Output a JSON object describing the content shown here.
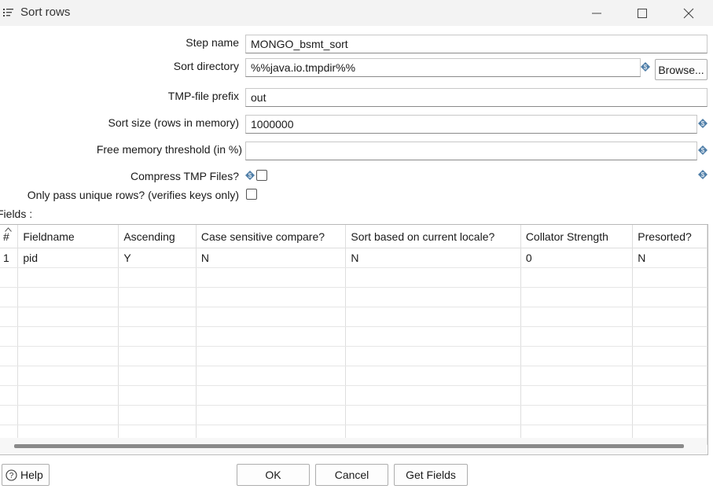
{
  "window": {
    "title": "Sort rows",
    "icon": "sort-list-icon"
  },
  "form": {
    "step_name_label": "Step name",
    "step_name_value": "MONGO_bsmt_sort",
    "sort_directory_label": "Sort directory",
    "sort_directory_value": "%%java.io.tmpdir%%",
    "browse_label": "Browse...",
    "tmp_prefix_label": "TMP-file prefix",
    "tmp_prefix_value": "out",
    "sort_size_label": "Sort size (rows in memory)",
    "sort_size_value": "1000000",
    "free_memory_label": "Free memory threshold (in %)",
    "free_memory_value": "",
    "compress_label": "Compress TMP Files?",
    "compress_checked": false,
    "unique_label": "Only pass unique rows? (verifies keys only)",
    "unique_checked": false,
    "variable_icon": "variable-diamond-icon"
  },
  "fields": {
    "label": "Fields :",
    "columns": [
      "#",
      "Fieldname",
      "Ascending",
      "Case sensitive compare?",
      "Sort based on current locale?",
      "Collator Strength",
      "Presorted?"
    ],
    "rows": [
      [
        "1",
        "pid",
        "Y",
        "N",
        "N",
        "0",
        "N"
      ]
    ]
  },
  "buttons": {
    "help": "Help",
    "ok": "OK",
    "cancel": "Cancel",
    "get_fields": "Get Fields"
  }
}
